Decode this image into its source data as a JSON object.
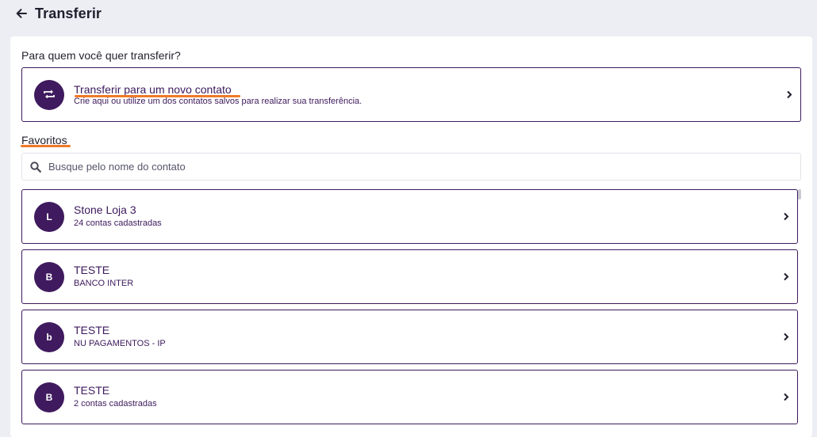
{
  "header": {
    "title": "Transferir"
  },
  "question": "Para quem você quer transferir?",
  "new_contact": {
    "title": "Transferir para um novo contato",
    "subtitle": "Crie aqui ou utilize um dos contatos salvos para realizar sua transferência."
  },
  "favorites": {
    "label": "Favoritos",
    "search_placeholder": "Busque pelo nome do contato",
    "contacts": [
      {
        "initial": "L",
        "name": "Stone Loja 3",
        "detail": "24 contas cadastradas"
      },
      {
        "initial": "B",
        "name": "TESTE",
        "detail": "BANCO INTER"
      },
      {
        "initial": "b",
        "name": "TESTE",
        "detail": "NU PAGAMENTOS - IP"
      },
      {
        "initial": "B",
        "name": "TESTE",
        "detail": "2 contas cadastradas"
      }
    ]
  },
  "colors": {
    "primary": "#3f1a5e",
    "accent": "#f07a28",
    "background": "#eceef3"
  },
  "icons": {
    "back": "arrow-left-icon",
    "transfer": "transfer-arrows-icon",
    "search": "search-icon",
    "chevron": "chevron-right-icon"
  }
}
